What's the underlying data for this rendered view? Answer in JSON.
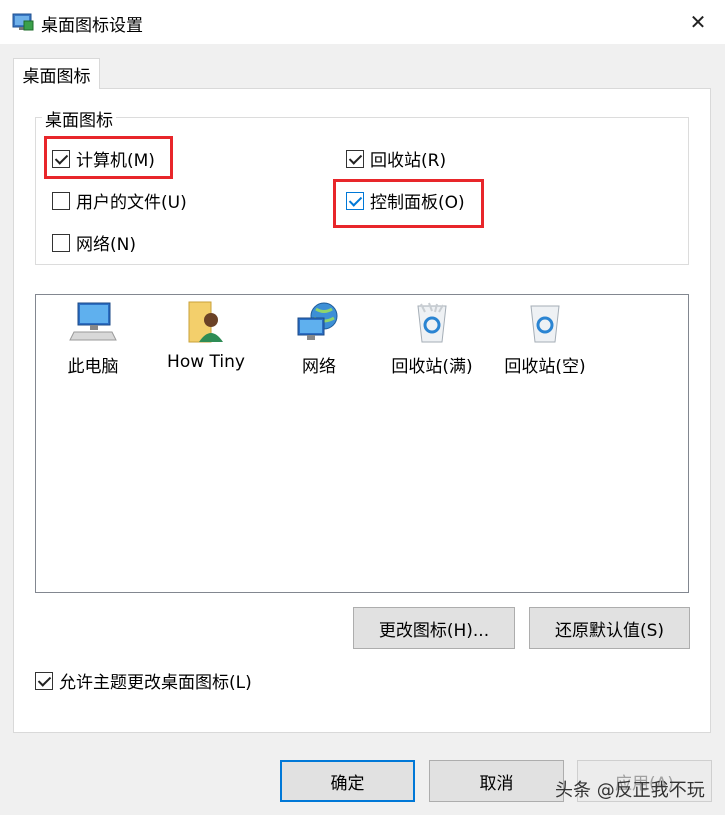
{
  "window": {
    "title": "桌面图标设置",
    "icon": "display-settings-icon",
    "close_glyph": "✕"
  },
  "tab": {
    "label": "桌面图标"
  },
  "group": {
    "title": "桌面图标",
    "checkboxes": [
      {
        "label": "计算机(M)",
        "checked": true
      },
      {
        "label": "回收站(R)",
        "checked": true
      },
      {
        "label": "用户的文件(U)",
        "checked": false
      },
      {
        "label": "控制面板(O)",
        "checked": true
      },
      {
        "label": "网络(N)",
        "checked": false
      }
    ]
  },
  "icons": [
    {
      "label": "此电脑",
      "icon": "computer-icon"
    },
    {
      "label": "How Tiny",
      "icon": "user-folder-icon"
    },
    {
      "label": "网络",
      "icon": "network-globe-icon"
    },
    {
      "label": "回收站(满)",
      "icon": "recycle-bin-full-icon"
    },
    {
      "label": "回收站(空)",
      "icon": "recycle-bin-empty-icon"
    }
  ],
  "buttons": {
    "change_icon": "更改图标(H)...",
    "restore_default": "还原默认值(S)",
    "ok": "确定",
    "cancel": "取消",
    "apply": "应用(A)"
  },
  "allow_themes": {
    "label": "允许主题更改桌面图标(L)",
    "checked": true
  },
  "watermark": "头条 @反正我不玩",
  "colors": {
    "highlight_red": "#e8262a",
    "focus_blue": "#0078d7"
  }
}
